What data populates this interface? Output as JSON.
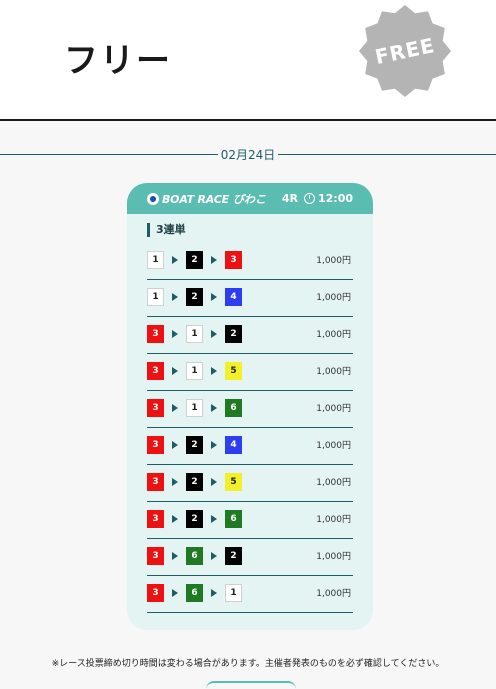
{
  "header": {
    "title": "フリー",
    "badge_label": "FREE",
    "badge_color": "#b4b4b4"
  },
  "date": "02月24日",
  "card": {
    "logo_text": "BOAT RACE",
    "venue": "びわこ",
    "race": "4R",
    "time": "12:00",
    "bet_type": "3連単",
    "boat_colors": {
      "1": {
        "bg": "#ffffff",
        "fg": "#222222"
      },
      "2": {
        "bg": "#000000",
        "fg": "#ffffff"
      },
      "3": {
        "bg": "#ee1111",
        "fg": "#ffffff"
      },
      "4": {
        "bg": "#2d3ef0",
        "fg": "#ffffff"
      },
      "5": {
        "bg": "#f3f02a",
        "fg": "#222222"
      },
      "6": {
        "bg": "#1f7a23",
        "fg": "#ffffff"
      }
    },
    "bets": [
      {
        "combo": [
          "1",
          "2",
          "3"
        ],
        "amount": "1,000円"
      },
      {
        "combo": [
          "1",
          "2",
          "4"
        ],
        "amount": "1,000円"
      },
      {
        "combo": [
          "3",
          "1",
          "2"
        ],
        "amount": "1,000円"
      },
      {
        "combo": [
          "3",
          "1",
          "5"
        ],
        "amount": "1,000円"
      },
      {
        "combo": [
          "3",
          "1",
          "6"
        ],
        "amount": "1,000円"
      },
      {
        "combo": [
          "3",
          "2",
          "4"
        ],
        "amount": "1,000円"
      },
      {
        "combo": [
          "3",
          "2",
          "5"
        ],
        "amount": "1,000円"
      },
      {
        "combo": [
          "3",
          "2",
          "6"
        ],
        "amount": "1,000円"
      },
      {
        "combo": [
          "3",
          "6",
          "2"
        ],
        "amount": "1,000円"
      },
      {
        "combo": [
          "3",
          "6",
          "1"
        ],
        "amount": "1,000円"
      }
    ]
  },
  "notice": "※レース投票締め切り時間は変わる場合があります。主催者発表のものを必ず確認してください。"
}
